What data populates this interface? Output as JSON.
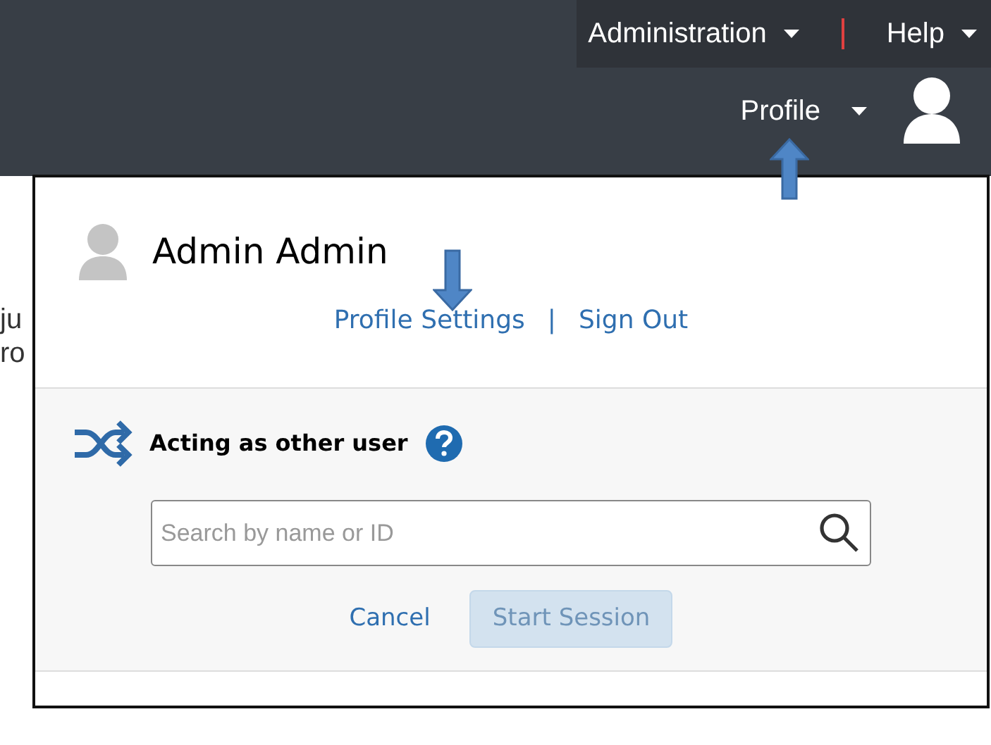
{
  "top_menu": [
    {
      "label": "Administration"
    },
    {
      "label": "Help"
    }
  ],
  "profile_menu": {
    "label": "Profile"
  },
  "background_text": [
    "ju",
    "ro"
  ],
  "dropdown": {
    "user_name": "Admin Admin",
    "links": [
      {
        "label": "Profile Settings"
      },
      {
        "label": "Sign Out"
      }
    ],
    "link_separator": "|"
  },
  "acting_as": {
    "title": "Acting as other user",
    "search": {
      "placeholder": "Search by name or ID"
    },
    "cancel": "Cancel",
    "start_session": {
      "label": "Start Session",
      "disabled": true
    }
  }
}
